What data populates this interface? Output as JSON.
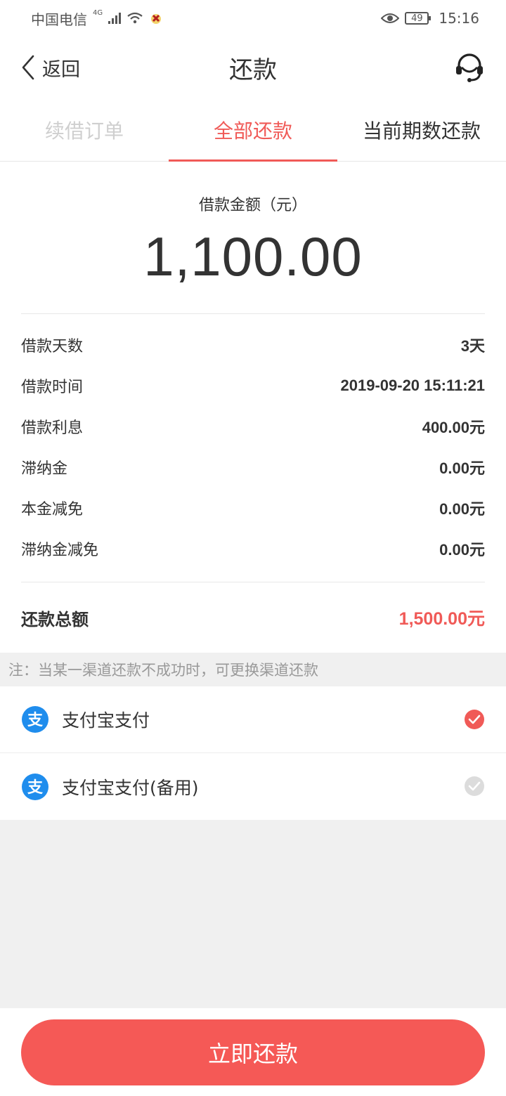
{
  "status_bar": {
    "carrier": "中国电信",
    "network": "4G",
    "battery": "49",
    "time": "15:16"
  },
  "nav": {
    "back_label": "返回",
    "title": "还款"
  },
  "tabs": [
    {
      "label": "续借订单",
      "state": "disabled"
    },
    {
      "label": "全部还款",
      "state": "active"
    },
    {
      "label": "当前期数还款",
      "state": "normal"
    }
  ],
  "amount": {
    "label": "借款金额（元）",
    "value": "1,100.00"
  },
  "details": [
    {
      "key": "借款天数",
      "value": "3天"
    },
    {
      "key": "借款时间",
      "value": "2019-09-20 15:11:21"
    },
    {
      "key": "借款利息",
      "value": "400.00元"
    },
    {
      "key": "滞纳金",
      "value": "0.00元"
    },
    {
      "key": "本金减免",
      "value": "0.00元"
    },
    {
      "key": "滞纳金减免",
      "value": "0.00元"
    }
  ],
  "total": {
    "key": "还款总额",
    "value": "1,500.00元"
  },
  "note": "注：当某一渠道还款不成功时，可更换渠道还款",
  "payment_methods": [
    {
      "label": "支付宝支付",
      "icon": "alipay-icon",
      "selected": true
    },
    {
      "label": "支付宝支付(备用)",
      "icon": "alipay-icon",
      "selected": false
    }
  ],
  "submit_label": "立即还款",
  "colors": {
    "accent": "#f05a57",
    "button": "#f55956",
    "alipay": "#1f8ded"
  }
}
